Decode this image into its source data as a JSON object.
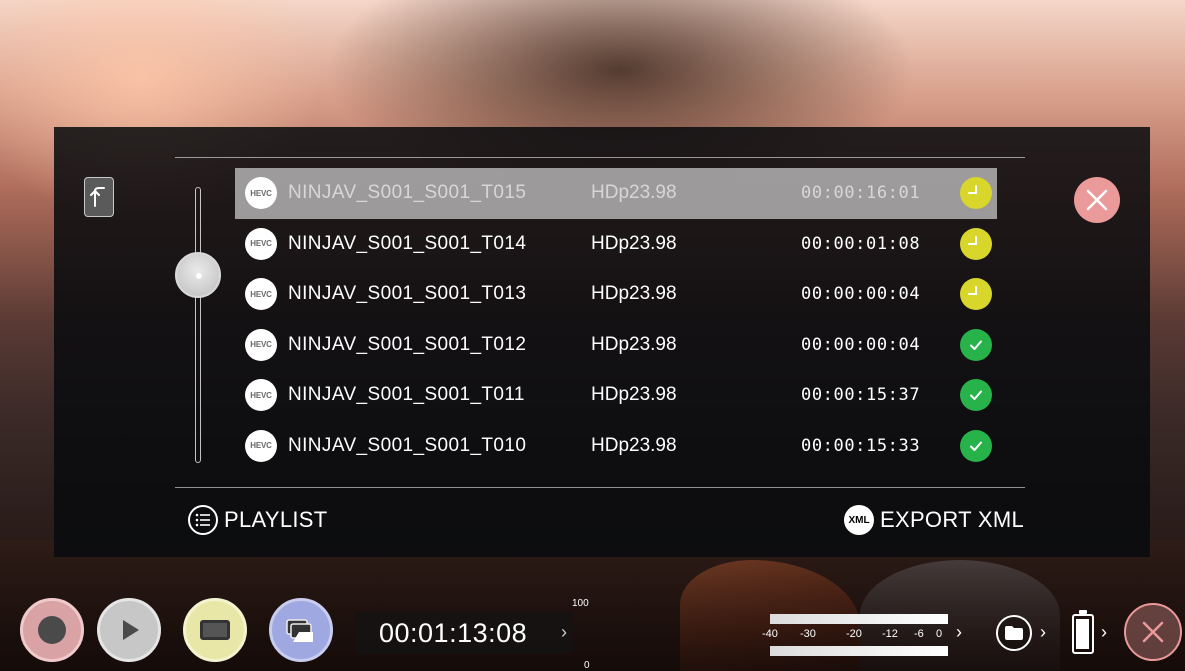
{
  "files": [
    {
      "codec": "HEVC",
      "name": "NINJAV_S001_S001_T015",
      "format": "HDp23.98",
      "duration": "00:00:16:01",
      "status": "pending",
      "selected": true
    },
    {
      "codec": "HEVC",
      "name": "NINJAV_S001_S001_T014",
      "format": "HDp23.98",
      "duration": "00:00:01:08",
      "status": "pending",
      "selected": false
    },
    {
      "codec": "HEVC",
      "name": "NINJAV_S001_S001_T013",
      "format": "HDp23.98",
      "duration": "00:00:00:04",
      "status": "pending",
      "selected": false
    },
    {
      "codec": "HEVC",
      "name": "NINJAV_S001_S001_T012",
      "format": "HDp23.98",
      "duration": "00:00:00:04",
      "status": "done",
      "selected": false
    },
    {
      "codec": "HEVC",
      "name": "NINJAV_S001_S001_T011",
      "format": "HDp23.98",
      "duration": "00:00:15:37",
      "status": "done",
      "selected": false
    },
    {
      "codec": "HEVC",
      "name": "NINJAV_S001_S001_T010",
      "format": "HDp23.98",
      "duration": "00:00:15:33",
      "status": "done",
      "selected": false
    }
  ],
  "footer": {
    "playlist_label": "PLAYLIST",
    "export_label": "EXPORT XML",
    "export_icon_text": "XML"
  },
  "bottom_bar": {
    "timecode": "00:01:13:08",
    "scale_top": "100",
    "scale_bottom": "0",
    "meter_scale": [
      "-40",
      "-30",
      "-20",
      "-12",
      "-6",
      "0"
    ]
  },
  "icons": {
    "up": "up-arrow-icon",
    "close": "close-icon",
    "status_pending": "clock-icon",
    "status_done": "check-icon",
    "playlist": "list-icon",
    "folder": "folder-icon",
    "battery": "battery-icon"
  },
  "colors": {
    "pending": "#d8d62a",
    "done": "#27b24a",
    "close": "#e99a99",
    "record": "#d9a3a6",
    "screen": "#e9e7a8",
    "layers": "#9fa8e0"
  }
}
